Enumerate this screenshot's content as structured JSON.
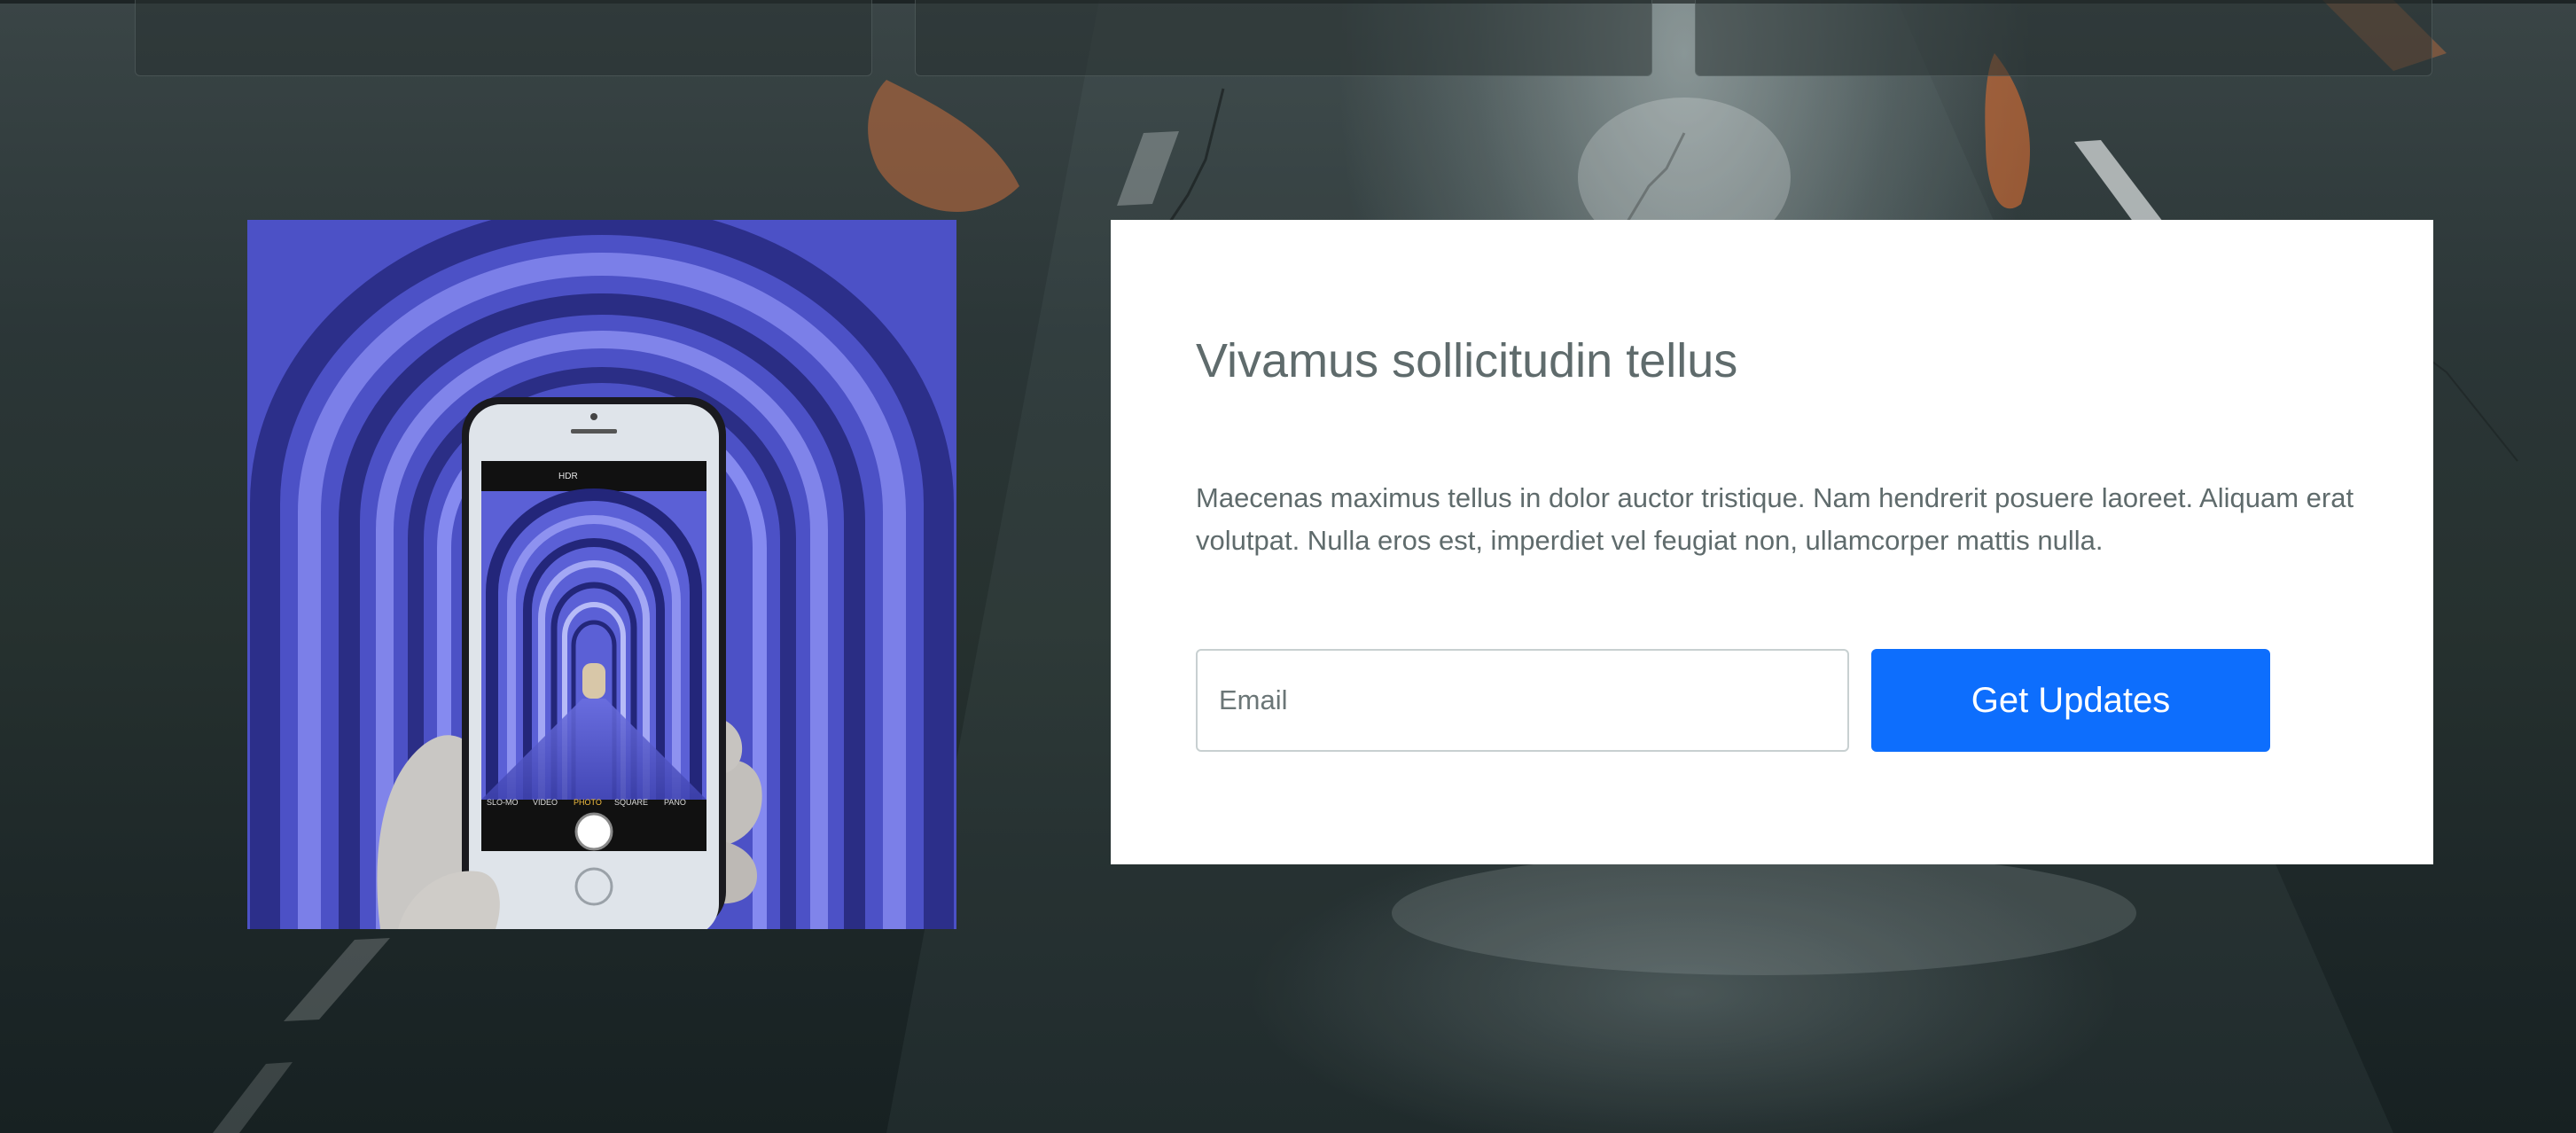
{
  "subscribe": {
    "title": "Vivamus sollicitudin tellus",
    "text": "Maecenas maximus tellus in dolor auctor tristique. Nam hendrerit posuere laoreet. Aliquam erat volutpat. Nulla eros est, imperdiet vel feugiat non, ullamcorper mattis nulla.",
    "email_placeholder": "Email",
    "button_label": "Get Updates"
  },
  "camera": {
    "top_label": "HDR",
    "modes": [
      "SLO-MO",
      "VIDEO",
      "PHOTO",
      "SQUARE",
      "PANO"
    ]
  },
  "colors": {
    "accent": "#0d6efd",
    "text": "#5f6b6c",
    "card": "#ffffff",
    "arch_blue": "#4a4fc4"
  }
}
